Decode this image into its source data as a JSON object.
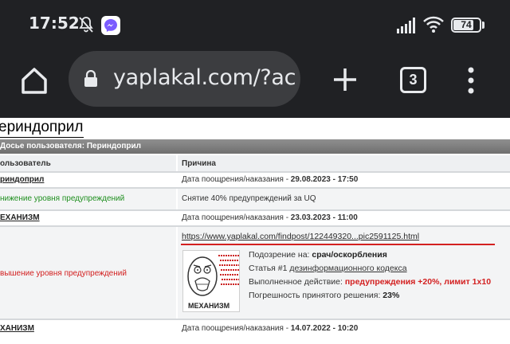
{
  "status_bar": {
    "time": "17:52",
    "icons": [
      "bell-off-icon",
      "messenger-icon",
      "signal-icon",
      "wifi-icon"
    ],
    "battery_level": "74"
  },
  "browser": {
    "url": "yaplakal.com/?ac",
    "tab_count": "3",
    "icons": [
      "home-icon",
      "lock-icon",
      "plus-icon",
      "more-vert-icon"
    ]
  },
  "page": {
    "title": "ериндоприл",
    "dossier_header": "Досье пользователя: Периндоприл",
    "columns": [
      "ользователь",
      "Причина"
    ],
    "rows": [
      {
        "left": "риндоприл",
        "right_label": "Дата поощрения/наказания - ",
        "right_date": "29.08.2023 - 17:50"
      },
      {
        "left": "нижение уровня предупреждений",
        "right": "Снятие 40% предупреждений за UQ"
      },
      {
        "left": "ЕХАНИЗМ",
        "right_label": "Дата поощрения/наказания - ",
        "right_date": "23.03.2023 - 11:00"
      },
      {
        "left": "вышение уровня предупреждений",
        "link": "https://www.yaplakal.com/findpost/122449320...pic2591125.html",
        "suspicion_label": "Подозрение на: ",
        "suspicion_value": "срач/оскорбления",
        "article_label": "Статья #1 ",
        "article_value": "дезинформационного кодекса",
        "action_label": "Выполненное действие: ",
        "action_value": "предупреждения +20%, лимит 1х10",
        "error_label": "Погрешность принятого решения: ",
        "error_value": "23%",
        "avatar_caption": "МЕХАНИЗМ"
      },
      {
        "left": "ХАНИЗМ",
        "right_label": "Дата поощрения/наказания - ",
        "right_date": "14.07.2022 - 10:20"
      }
    ]
  }
}
